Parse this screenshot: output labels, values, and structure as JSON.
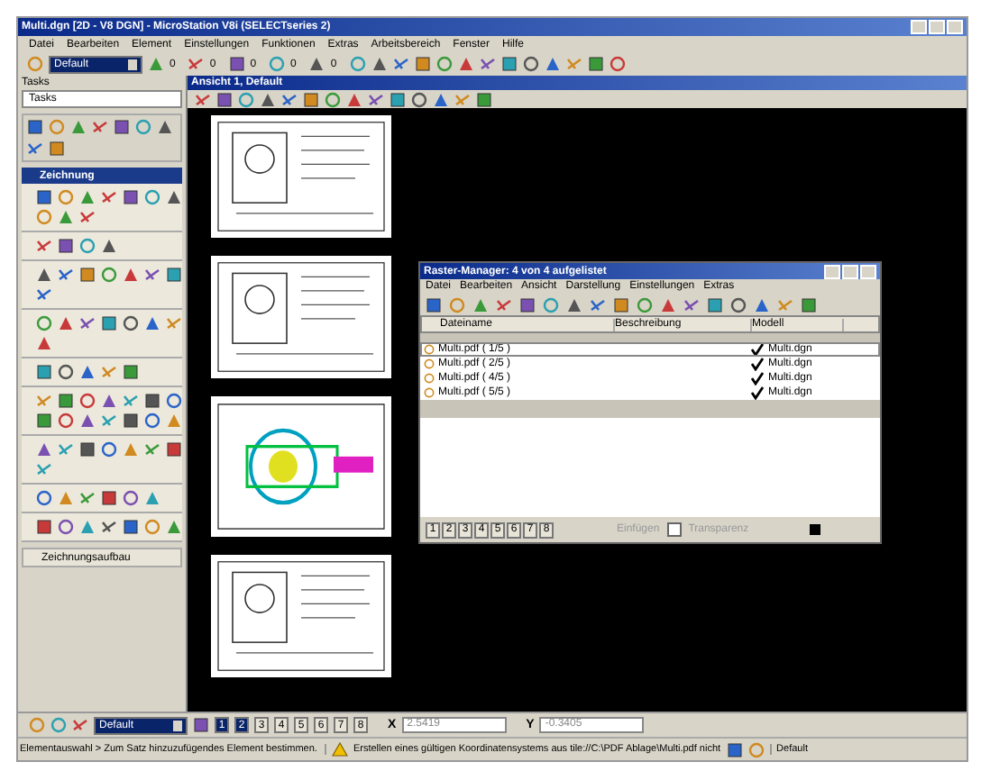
{
  "window": {
    "title": "Multi.dgn [2D - V8 DGN] - MicroStation V8i (SELECTseries 2)"
  },
  "menu": [
    "Datei",
    "Bearbeiten",
    "Element",
    "Einstellungen",
    "Funktionen",
    "Extras",
    "Arbeitsbereich",
    "Fenster",
    "Hilfe"
  ],
  "toolbar": {
    "level": "Default",
    "counters": [
      "0",
      "0",
      "0",
      "0",
      "0"
    ]
  },
  "tasks_panel": {
    "title": "Tasks",
    "dropdown": "Tasks",
    "section": "Zeichnung",
    "footer": "Zeichnungsaufbau"
  },
  "view": {
    "title": "Ansicht 1, Default"
  },
  "raster_manager": {
    "title": "Raster-Manager: 4 von 4 aufgelistet",
    "menu": [
      "Datei",
      "Bearbeiten",
      "Ansicht",
      "Darstellung",
      "Einstellungen",
      "Extras"
    ],
    "columns": [
      "Dateiname",
      "Beschreibung",
      "Modell"
    ],
    "rows": [
      {
        "file": "Multi.pdf ( 1/5 )",
        "checked": true,
        "model": "Multi.dgn",
        "selected": true
      },
      {
        "file": "Multi.pdf ( 2/5 )",
        "checked": true,
        "model": "Multi.dgn",
        "selected": false
      },
      {
        "file": "Multi.pdf ( 4/5 )",
        "checked": true,
        "model": "Multi.dgn",
        "selected": false
      },
      {
        "file": "Multi.pdf ( 5/5 )",
        "checked": true,
        "model": "Multi.dgn",
        "selected": false
      }
    ],
    "view_buttons": [
      "1",
      "2",
      "3",
      "4",
      "5",
      "6",
      "7",
      "8"
    ],
    "insert": "Einfügen",
    "transparency": {
      "label": "Transparenz",
      "checked": false
    }
  },
  "bottom_bar": {
    "level": "Default",
    "view_buttons": [
      {
        "label": "1",
        "selected": true
      },
      {
        "label": "2",
        "selected": true
      },
      {
        "label": "3",
        "selected": false
      },
      {
        "label": "4",
        "selected": false
      },
      {
        "label": "5",
        "selected": false
      },
      {
        "label": "6",
        "selected": false
      },
      {
        "label": "7",
        "selected": false
      },
      {
        "label": "8",
        "selected": false
      }
    ],
    "x_label": "X",
    "x_value": "2.5419",
    "y_label": "Y",
    "y_value": "-0.3405"
  },
  "status_bar": {
    "prompt": "Elementauswahl > Zum Satz hinzuzufügendes Element bestimmen.",
    "message": "Erstellen eines gültigen Koordinatensystems aus tile://C:\\PDF Ablage\\Multi.pdf nicht",
    "model": "Default"
  }
}
